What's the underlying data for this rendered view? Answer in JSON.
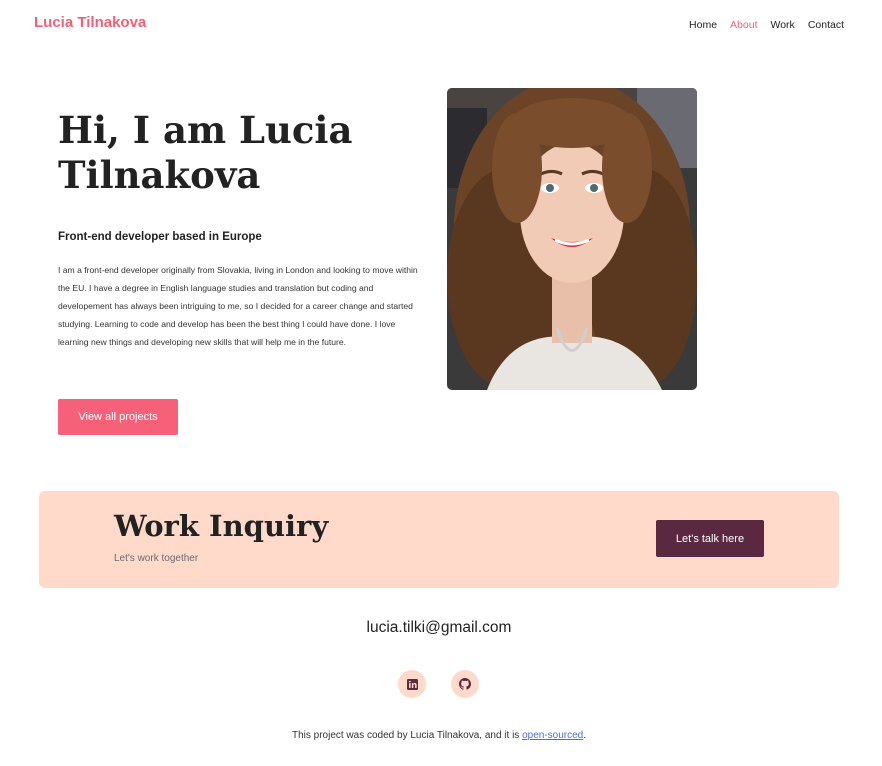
{
  "header": {
    "brand": "Lucia Tilnakova",
    "nav": [
      {
        "label": "Home",
        "active": false
      },
      {
        "label": "About",
        "active": true
      },
      {
        "label": "Work",
        "active": false
      },
      {
        "label": "Contact",
        "active": false
      }
    ]
  },
  "hero": {
    "title": "Hi, I am Lucia Tilnakova",
    "subtitle": "Front-end developer based in Europe",
    "bio": "I am a front-end developer originally from Slovakia, living in London and looking to move within the EU. I have a degree in English language studies and translation but coding and developement has always been intriguing to me, so I decided for a career change and started studying. Learning to code and develop has been the best thing I could have done. I love learning new things and developing new skills that will help me in the future.",
    "cta_label": "View all projects",
    "portrait_icon": "portrait-photo"
  },
  "inquiry": {
    "title": "Work Inquiry",
    "subtitle": "Let's work together",
    "button_label": "Let's talk here"
  },
  "contact": {
    "email": "lucia.tilki@gmail.com",
    "socials": [
      {
        "icon": "linkedin-icon"
      },
      {
        "icon": "github-icon"
      }
    ]
  },
  "footer": {
    "text_before": "This project was coded by Lucia Tilnakova, and it is ",
    "link_text": "open-sourced",
    "text_after": "."
  },
  "colors": {
    "accent": "#f06178",
    "button_primary": "#f66179",
    "banner_bg": "#ffdacb",
    "button_dark": "#5a2841",
    "link": "#4a6fd8"
  }
}
